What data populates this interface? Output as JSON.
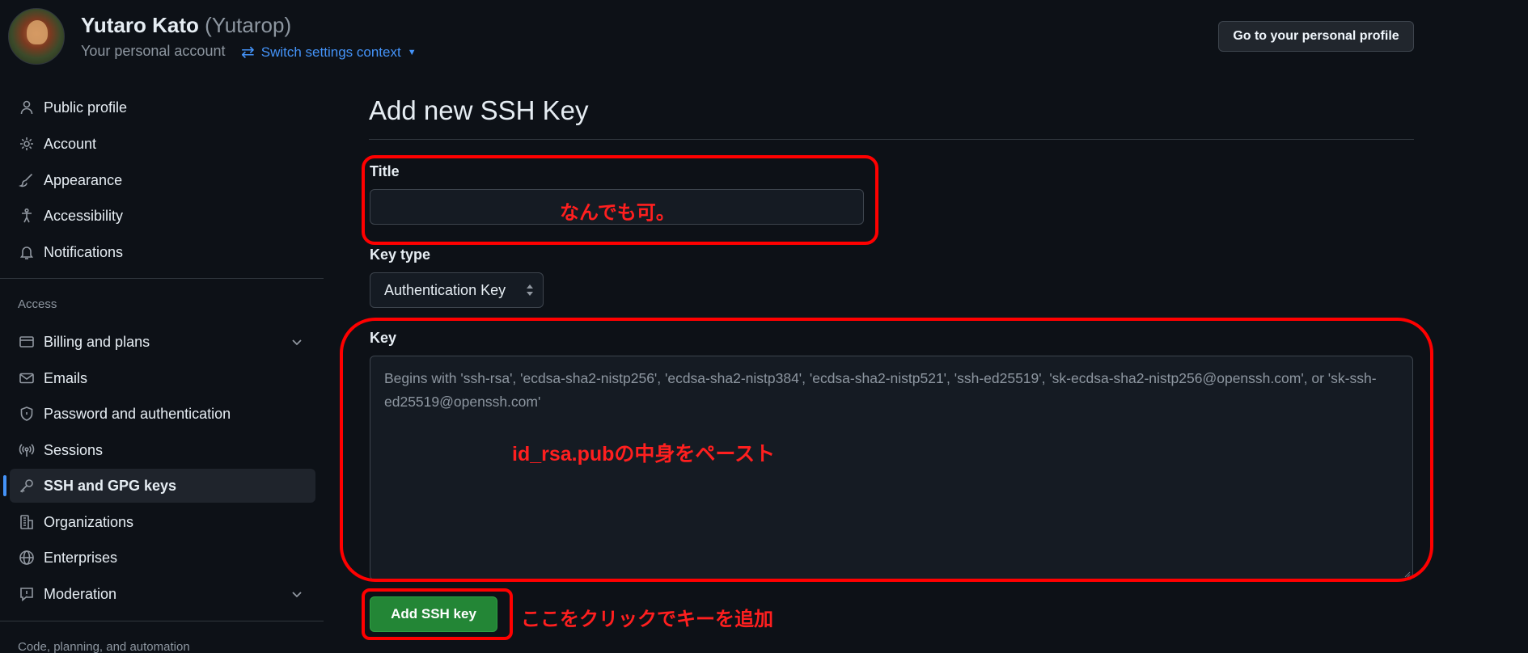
{
  "header": {
    "user_name": "Yutaro Kato",
    "user_login": "(Yutarop)",
    "account_type": "Your personal account",
    "switch_context": "Switch settings context",
    "profile_button": "Go to your personal profile"
  },
  "sidebar": {
    "items": [
      {
        "label": "Public profile",
        "icon": "person-icon"
      },
      {
        "label": "Account",
        "icon": "gear-icon"
      },
      {
        "label": "Appearance",
        "icon": "paintbrush-icon"
      },
      {
        "label": "Accessibility",
        "icon": "accessibility-icon"
      },
      {
        "label": "Notifications",
        "icon": "bell-icon"
      }
    ],
    "access_heading": "Access",
    "access_items": [
      {
        "label": "Billing and plans",
        "icon": "credit-card-icon"
      },
      {
        "label": "Emails",
        "icon": "mail-icon"
      },
      {
        "label": "Password and authentication",
        "icon": "shield-icon"
      },
      {
        "label": "Sessions",
        "icon": "broadcast-icon"
      },
      {
        "label": "SSH and GPG keys",
        "icon": "key-icon",
        "active": true
      },
      {
        "label": "Organizations",
        "icon": "organization-icon"
      },
      {
        "label": "Enterprises",
        "icon": "globe-icon"
      },
      {
        "label": "Moderation",
        "icon": "report-icon"
      }
    ],
    "code_heading": "Code, planning, and automation"
  },
  "main": {
    "title": "Add new SSH Key",
    "title_label": "Title",
    "title_value": "",
    "key_type_label": "Key type",
    "key_type_value": "Authentication Key",
    "key_label": "Key",
    "key_placeholder": "Begins with 'ssh-rsa', 'ecdsa-sha2-nistp256', 'ecdsa-sha2-nistp384', 'ecdsa-sha2-nistp521', 'ssh-ed25519', 'sk-ecdsa-sha2-nistp256@openssh.com', or 'sk-ssh-ed25519@openssh.com'",
    "add_button": "Add SSH key"
  },
  "annotations": {
    "title_note": "なんでも可。",
    "key_note": "id_rsa.pubの中身をペースト",
    "button_note": "ここをクリックでキーを追加",
    "color": "#ff0000"
  },
  "colors": {
    "background": "#0d1117",
    "accent": "#4493f8",
    "primary_button": "#238636"
  }
}
